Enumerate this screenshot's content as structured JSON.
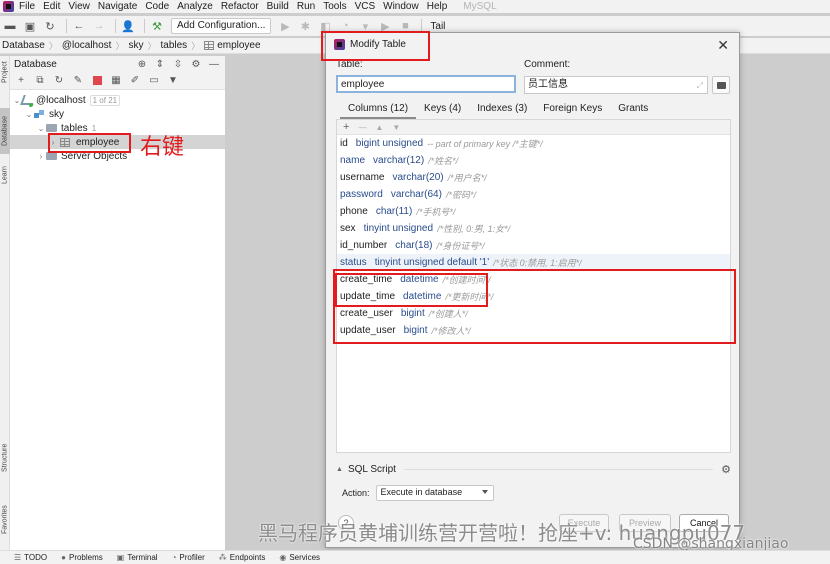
{
  "menubar": {
    "items": [
      "File",
      "Edit",
      "View",
      "Navigate",
      "Code",
      "Analyze",
      "Refactor",
      "Build",
      "Run",
      "Tools",
      "VCS",
      "Window",
      "Help"
    ],
    "project_label": "MySQL"
  },
  "toolbar": {
    "add_config_label": "Add Configuration...",
    "tail_label": "Tail"
  },
  "breadcrumb": [
    "Database",
    "@localhost",
    "sky",
    "tables",
    "employee"
  ],
  "left_stripe": {
    "tabs": [
      "Project",
      "Database",
      "Learn",
      "Structure",
      "Favorites"
    ]
  },
  "db_panel": {
    "title": "Database",
    "tree": {
      "host": "@localhost",
      "host_badge": "1 of 21",
      "schema": "sky",
      "tables_label": "tables",
      "tables_count": "1",
      "table": "employee",
      "server_objects": "Server Objects"
    },
    "annotation": "右键"
  },
  "dialog": {
    "title": "Modify Table",
    "table_label": "Table:",
    "table_value": "employee",
    "comment_label": "Comment:",
    "comment_value": "员工信息",
    "tabs": [
      "Columns (12)",
      "Keys (4)",
      "Indexes (3)",
      "Foreign Keys",
      "Grants"
    ],
    "active_tab": "Columns (12)",
    "columns": [
      {
        "name": "id",
        "type": "bigint unsigned",
        "comment": "-- part of primary key /*主键*/"
      },
      {
        "name": "name",
        "type": "varchar(12)",
        "comment": "/*姓名*/"
      },
      {
        "name": "username",
        "type": "varchar(20)",
        "comment": "/*用户名*/"
      },
      {
        "name": "password",
        "type": "varchar(64)",
        "comment": "/*密码*/"
      },
      {
        "name": "phone",
        "type": "char(11)",
        "comment": "/*手机号*/"
      },
      {
        "name": "sex",
        "type": "tinyint unsigned",
        "comment": "/*性别, 0:男, 1:女*/"
      },
      {
        "name": "id_number",
        "type": "char(18)",
        "comment": "/*身份证号*/"
      },
      {
        "name": "status",
        "type": "tinyint unsigned default '1'",
        "comment": "/*状态 0:禁用, 1:启用*/"
      },
      {
        "name": "create_time",
        "type": "datetime",
        "comment": "/*创建时间*/"
      },
      {
        "name": "update_time",
        "type": "datetime",
        "comment": "/*更新时间*/"
      },
      {
        "name": "create_user",
        "type": "bigint",
        "comment": "/*创建人*/"
      },
      {
        "name": "update_user",
        "type": "bigint",
        "comment": "/*修改人*/"
      }
    ],
    "sql_script_label": "SQL Script",
    "action_label": "Action:",
    "action_value": "Execute in database",
    "help_label": "?",
    "buttons": {
      "execute": "Execute",
      "preview": "Preview",
      "cancel": "Cancel"
    }
  },
  "bottombar": {
    "items": [
      "TODO",
      "Problems",
      "Terminal",
      "Profiler",
      "Endpoints",
      "Services"
    ]
  },
  "watermarks": {
    "main": "黑马程序员黄埔训练营开营啦！抢座+v: huangpu077",
    "csdn": "CSDN @shangxianjiao"
  },
  "colors": {
    "annotation_red": "#e21c1c",
    "type_blue": "#2a4c8c",
    "comment_gray": "#9a9a9a"
  }
}
